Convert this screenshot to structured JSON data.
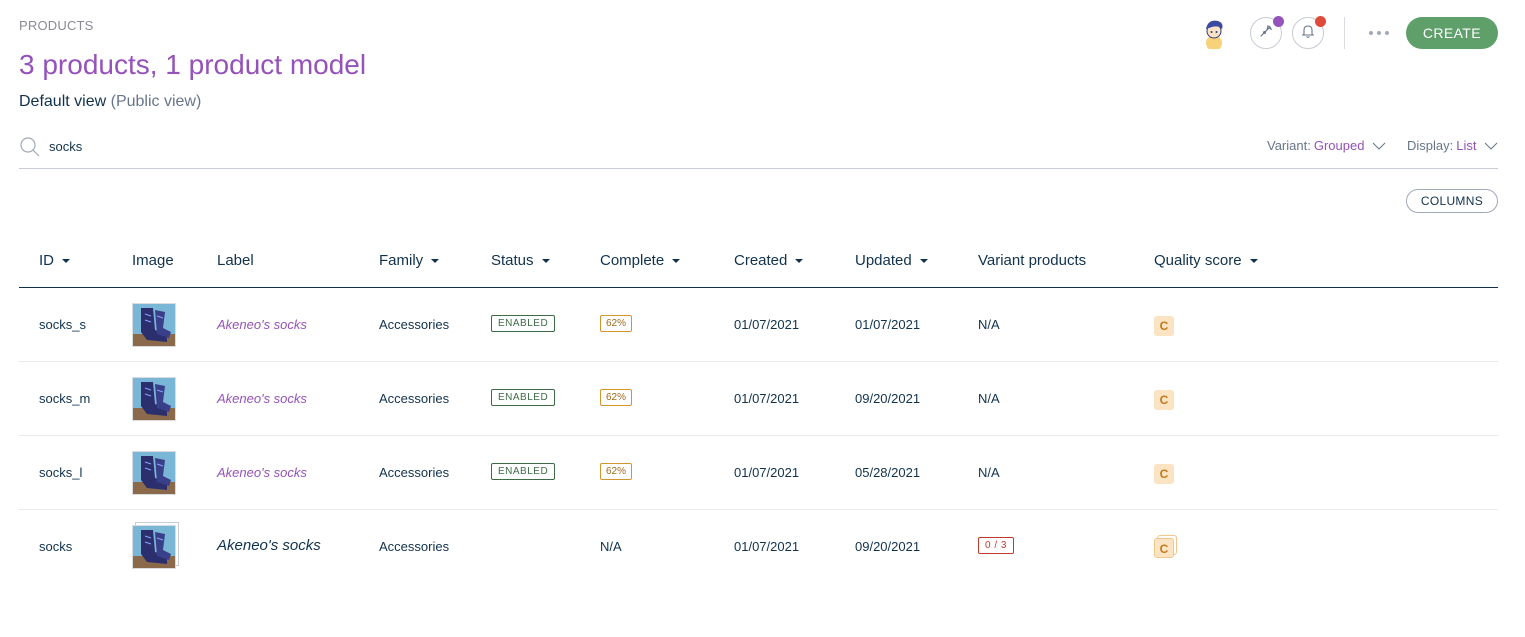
{
  "breadcrumb": "PRODUCTS",
  "page_title": "3 products, 1 product model",
  "view": {
    "name": "Default view",
    "scope": "(Public view)"
  },
  "header": {
    "create_label": "CREATE",
    "colors": {
      "accent": "#9452ba",
      "create": "#5e9f6a",
      "notif_dot": "#e04a3a",
      "activity_dot": "#9452ba"
    }
  },
  "search": {
    "value": "socks",
    "placeholder": ""
  },
  "filters": {
    "variant_label": "Variant:",
    "variant_value": "Grouped",
    "display_label": "Display:",
    "display_value": "List"
  },
  "columns_button": "COLUMNS",
  "table": {
    "headers": {
      "id": "ID",
      "image": "Image",
      "label": "Label",
      "family": "Family",
      "status": "Status",
      "complete": "Complete",
      "created": "Created",
      "updated": "Updated",
      "variant": "Variant products",
      "quality": "Quality score"
    },
    "rows": [
      {
        "id": "socks_s",
        "label": "Akeneo's socks",
        "family": "Accessories",
        "status": "ENABLED",
        "complete": "62%",
        "created": "01/07/2021",
        "updated": "01/07/2021",
        "variant": "N/A",
        "quality": "C"
      },
      {
        "id": "socks_m",
        "label": "Akeneo's socks",
        "family": "Accessories",
        "status": "ENABLED",
        "complete": "62%",
        "created": "01/07/2021",
        "updated": "09/20/2021",
        "variant": "N/A",
        "quality": "C"
      },
      {
        "id": "socks_l",
        "label": "Akeneo's socks",
        "family": "Accessories",
        "status": "ENABLED",
        "complete": "62%",
        "created": "01/07/2021",
        "updated": "05/28/2021",
        "variant": "N/A",
        "quality": "C"
      },
      {
        "id": "socks",
        "label": "Akeneo's socks",
        "family": "Accessories",
        "status": "",
        "complete": "N/A",
        "created": "01/07/2021",
        "updated": "09/20/2021",
        "variant": "0 / 3",
        "quality": "C"
      }
    ]
  }
}
